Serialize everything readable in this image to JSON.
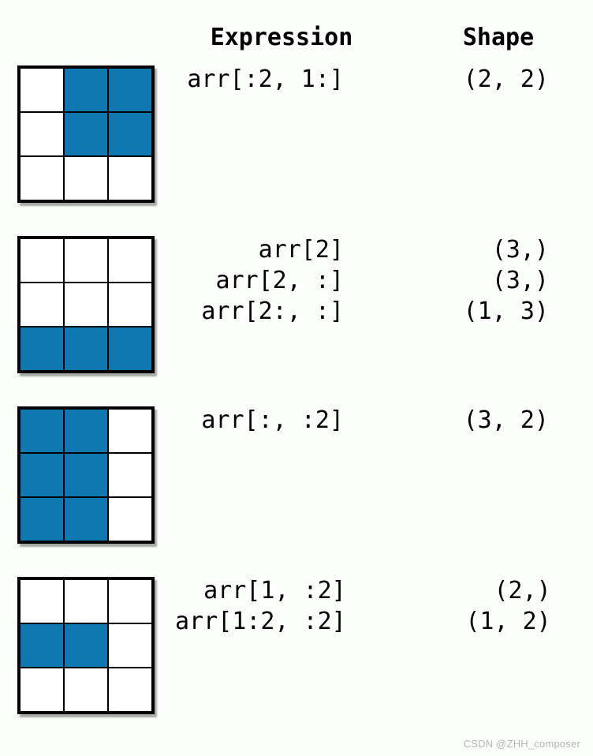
{
  "header": {
    "expression": "Expression",
    "shape": "Shape"
  },
  "rows": [
    {
      "filled": [
        [
          0,
          1
        ],
        [
          0,
          2
        ],
        [
          1,
          1
        ],
        [
          1,
          2
        ]
      ],
      "lines": [
        {
          "expression": "arr[:2, 1:]",
          "shape": "(2, 2)"
        }
      ]
    },
    {
      "filled": [
        [
          2,
          0
        ],
        [
          2,
          1
        ],
        [
          2,
          2
        ]
      ],
      "lines": [
        {
          "expression": "arr[2]",
          "shape": "(3,)"
        },
        {
          "expression": "arr[2, :]",
          "shape": "(3,)"
        },
        {
          "expression": "arr[2:, :]",
          "shape": "(1, 3)"
        }
      ]
    },
    {
      "filled": [
        [
          0,
          0
        ],
        [
          0,
          1
        ],
        [
          1,
          0
        ],
        [
          1,
          1
        ],
        [
          2,
          0
        ],
        [
          2,
          1
        ]
      ],
      "lines": [
        {
          "expression": "arr[:, :2]",
          "shape": "(3, 2)"
        }
      ]
    },
    {
      "filled": [
        [
          1,
          0
        ],
        [
          1,
          1
        ]
      ],
      "lines": [
        {
          "expression": "arr[1, :2]",
          "shape": "(2,)"
        },
        {
          "expression": "arr[1:2, :2]",
          "shape": "(1, 2)"
        }
      ]
    }
  ],
  "watermark": "CSDN @ZHH_composer"
}
